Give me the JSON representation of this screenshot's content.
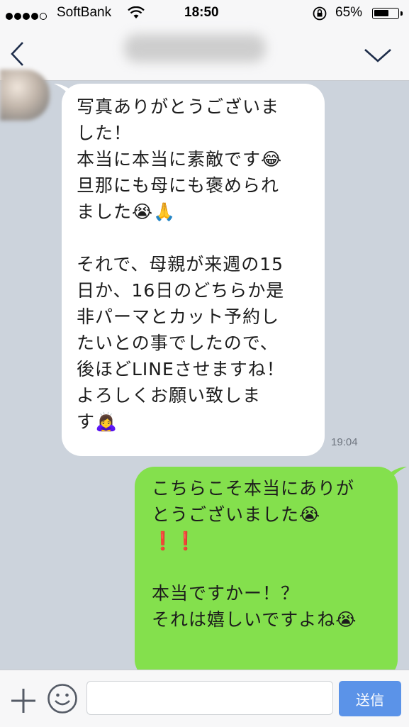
{
  "status_bar": {
    "carrier": "SoftBank",
    "time": "18:50",
    "battery_percent": "65%",
    "battery_level": 0.65,
    "signal_bars": 4
  },
  "header": {
    "title": ""
  },
  "messages": [
    {
      "direction": "incoming",
      "text": "写真ありがとうございま\nした！\n本当に本当に素敵です😂\n旦那にも母にも褒められ\nました😭🙏\n\nそれで、母親が来週の15\n日か、16日のどちらか是\n非パーマとカット予約し\nたいとの事でしたので、\n後ほどLINEさせますね！\nよろしくお願い致しま\nす🙇‍♀️",
      "time": "19:04"
    },
    {
      "direction": "outgoing",
      "text": "こちらこそ本当にありが\nとうございました😭\n❗❗\n\n本当ですかー！？\nそれは嬉しいですよね😭"
    }
  ],
  "input_bar": {
    "placeholder": "",
    "send_label": "送信"
  },
  "icons": {
    "back": "chevron-left-icon",
    "menu": "chevron-down-icon",
    "add": "plus-icon",
    "sticker": "smile-icon"
  },
  "colors": {
    "background": "#ccd3dc",
    "outgoing_bubble": "#84e04d",
    "incoming_bubble": "#ffffff",
    "send_button": "#5b93e8",
    "accent": "#1e2d4a"
  }
}
